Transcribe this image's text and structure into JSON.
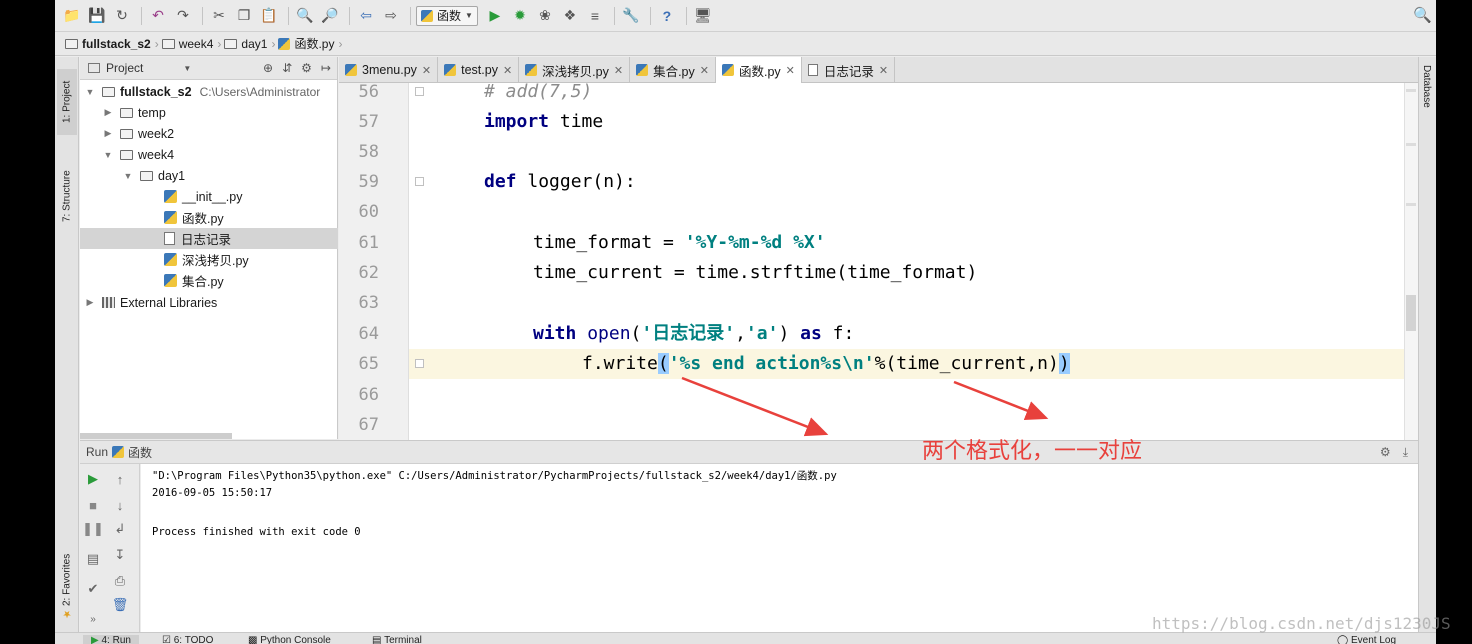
{
  "toolbar": {
    "run_config": "函数"
  },
  "nav": {
    "crumbs": [
      "fullstack_s2",
      "week4",
      "day1",
      "函数.py"
    ]
  },
  "left_tools": {
    "project": "1: Project",
    "structure": "7: Structure",
    "favorites": "2: Favorites"
  },
  "right_tools": {
    "database": "Database"
  },
  "project_panel": {
    "title": "Project",
    "root": {
      "name": "fullstack_s2",
      "path": "C:\\Users\\Administrator"
    },
    "items": [
      {
        "name": "temp"
      },
      {
        "name": "week2"
      },
      {
        "name": "week4"
      },
      {
        "name": "day1"
      },
      {
        "name": "__init__.py"
      },
      {
        "name": "函数.py"
      },
      {
        "name": "日志记录"
      },
      {
        "name": "深浅拷贝.py"
      },
      {
        "name": "集合.py"
      },
      {
        "name": "External Libraries"
      }
    ]
  },
  "tabs": [
    {
      "label": "3menu.py"
    },
    {
      "label": "test.py"
    },
    {
      "label": "深浅拷贝.py"
    },
    {
      "label": "集合.py"
    },
    {
      "label": "函数.py"
    },
    {
      "label": "日志记录"
    }
  ],
  "editor": {
    "line_numbers": [
      "56",
      "57",
      "58",
      "59",
      "60",
      "61",
      "62",
      "63",
      "64",
      "65",
      "66",
      "67"
    ],
    "code": {
      "l56": "# add(7,5)",
      "l57_kw": "import",
      "l57_rest": " time",
      "l59_kw": "def",
      "l59_rest": " logger(n):",
      "l61_a": "time_format = ",
      "l61_s": "'%Y-%m-%d %X'",
      "l62": "time_current = time.strftime(time_format)",
      "l64_kw": "with",
      "l64_bi": " open",
      "l64_p1": "(",
      "l64_s1": "'日志记录'",
      "l64_c": ",",
      "l64_s2": "'a'",
      "l64_p2": ") ",
      "l64_kw2": "as",
      "l64_r": " f:",
      "l65_a": "f.write",
      "l65_b1": "(",
      "l65_s": "'%s end action%s\\n'",
      "l65_m": "%(time_current,n)",
      "l65_b2": ")"
    }
  },
  "run_panel": {
    "title": "Run",
    "config": "函数",
    "console": [
      "\"D:\\Program Files\\Python35\\python.exe\" C:/Users/Administrator/PycharmProjects/fullstack_s2/week4/day1/函数.py",
      "2016-09-05 15:50:17",
      "",
      "Process finished with exit code 0"
    ]
  },
  "bottom_bar": {
    "run": "4: Run",
    "todo": "6: TODO",
    "python_console": "Python Console",
    "terminal": "Terminal",
    "event_log": "Event Log"
  },
  "annotation": "两个格式化，一一对应",
  "watermark": "https://blog.csdn.net/djs1230JS",
  "colors": {
    "keyword": "#000080",
    "string": "#008080",
    "annotation": "#e8413c",
    "current_line": "#fbf6e0",
    "bracket_match": "#99ccff"
  }
}
